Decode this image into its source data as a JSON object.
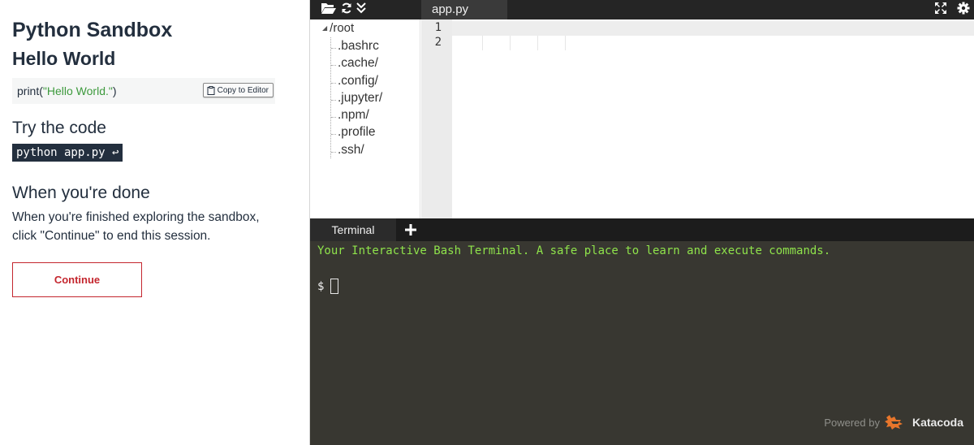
{
  "instructions": {
    "title": "Python Sandbox",
    "subtitle": "Hello World",
    "code_snippet": {
      "prefix": "print(",
      "string": "\"Hello World.\"",
      "suffix": ")",
      "copy_button_label": "Copy to Editor"
    },
    "try_heading": "Try the code",
    "command": "python app.py ↩",
    "done_heading": "When you're done",
    "done_text": "When you're finished exploring the sandbox, click \"Continue\" to end this session.",
    "continue_label": "Continue"
  },
  "ide": {
    "toolbar_icons": [
      "folder-open-icon",
      "refresh-icon",
      "collapse-icon"
    ],
    "open_tab": "app.py",
    "window_icons": [
      "fullscreen-icon",
      "settings-icon"
    ],
    "file_tree": {
      "root": "/root",
      "items": [
        ".bashrc",
        ".cache/",
        ".config/",
        ".jupyter/",
        ".npm/",
        ".profile",
        ".ssh/"
      ]
    },
    "editor": {
      "line_numbers": [
        "1",
        "2"
      ]
    },
    "terminal": {
      "tab_label": "Terminal",
      "welcome": "Your Interactive Bash Terminal. A safe place to learn and execute commands.",
      "prompt": "$"
    },
    "powered_by": {
      "label": "Powered by",
      "brand": "Katacoda"
    }
  },
  "colors": {
    "accent_red": "#c4262e",
    "terminal_green": "#8fe34b",
    "terminal_bg": "#383731",
    "code_string_green": "#3d9a3d"
  }
}
